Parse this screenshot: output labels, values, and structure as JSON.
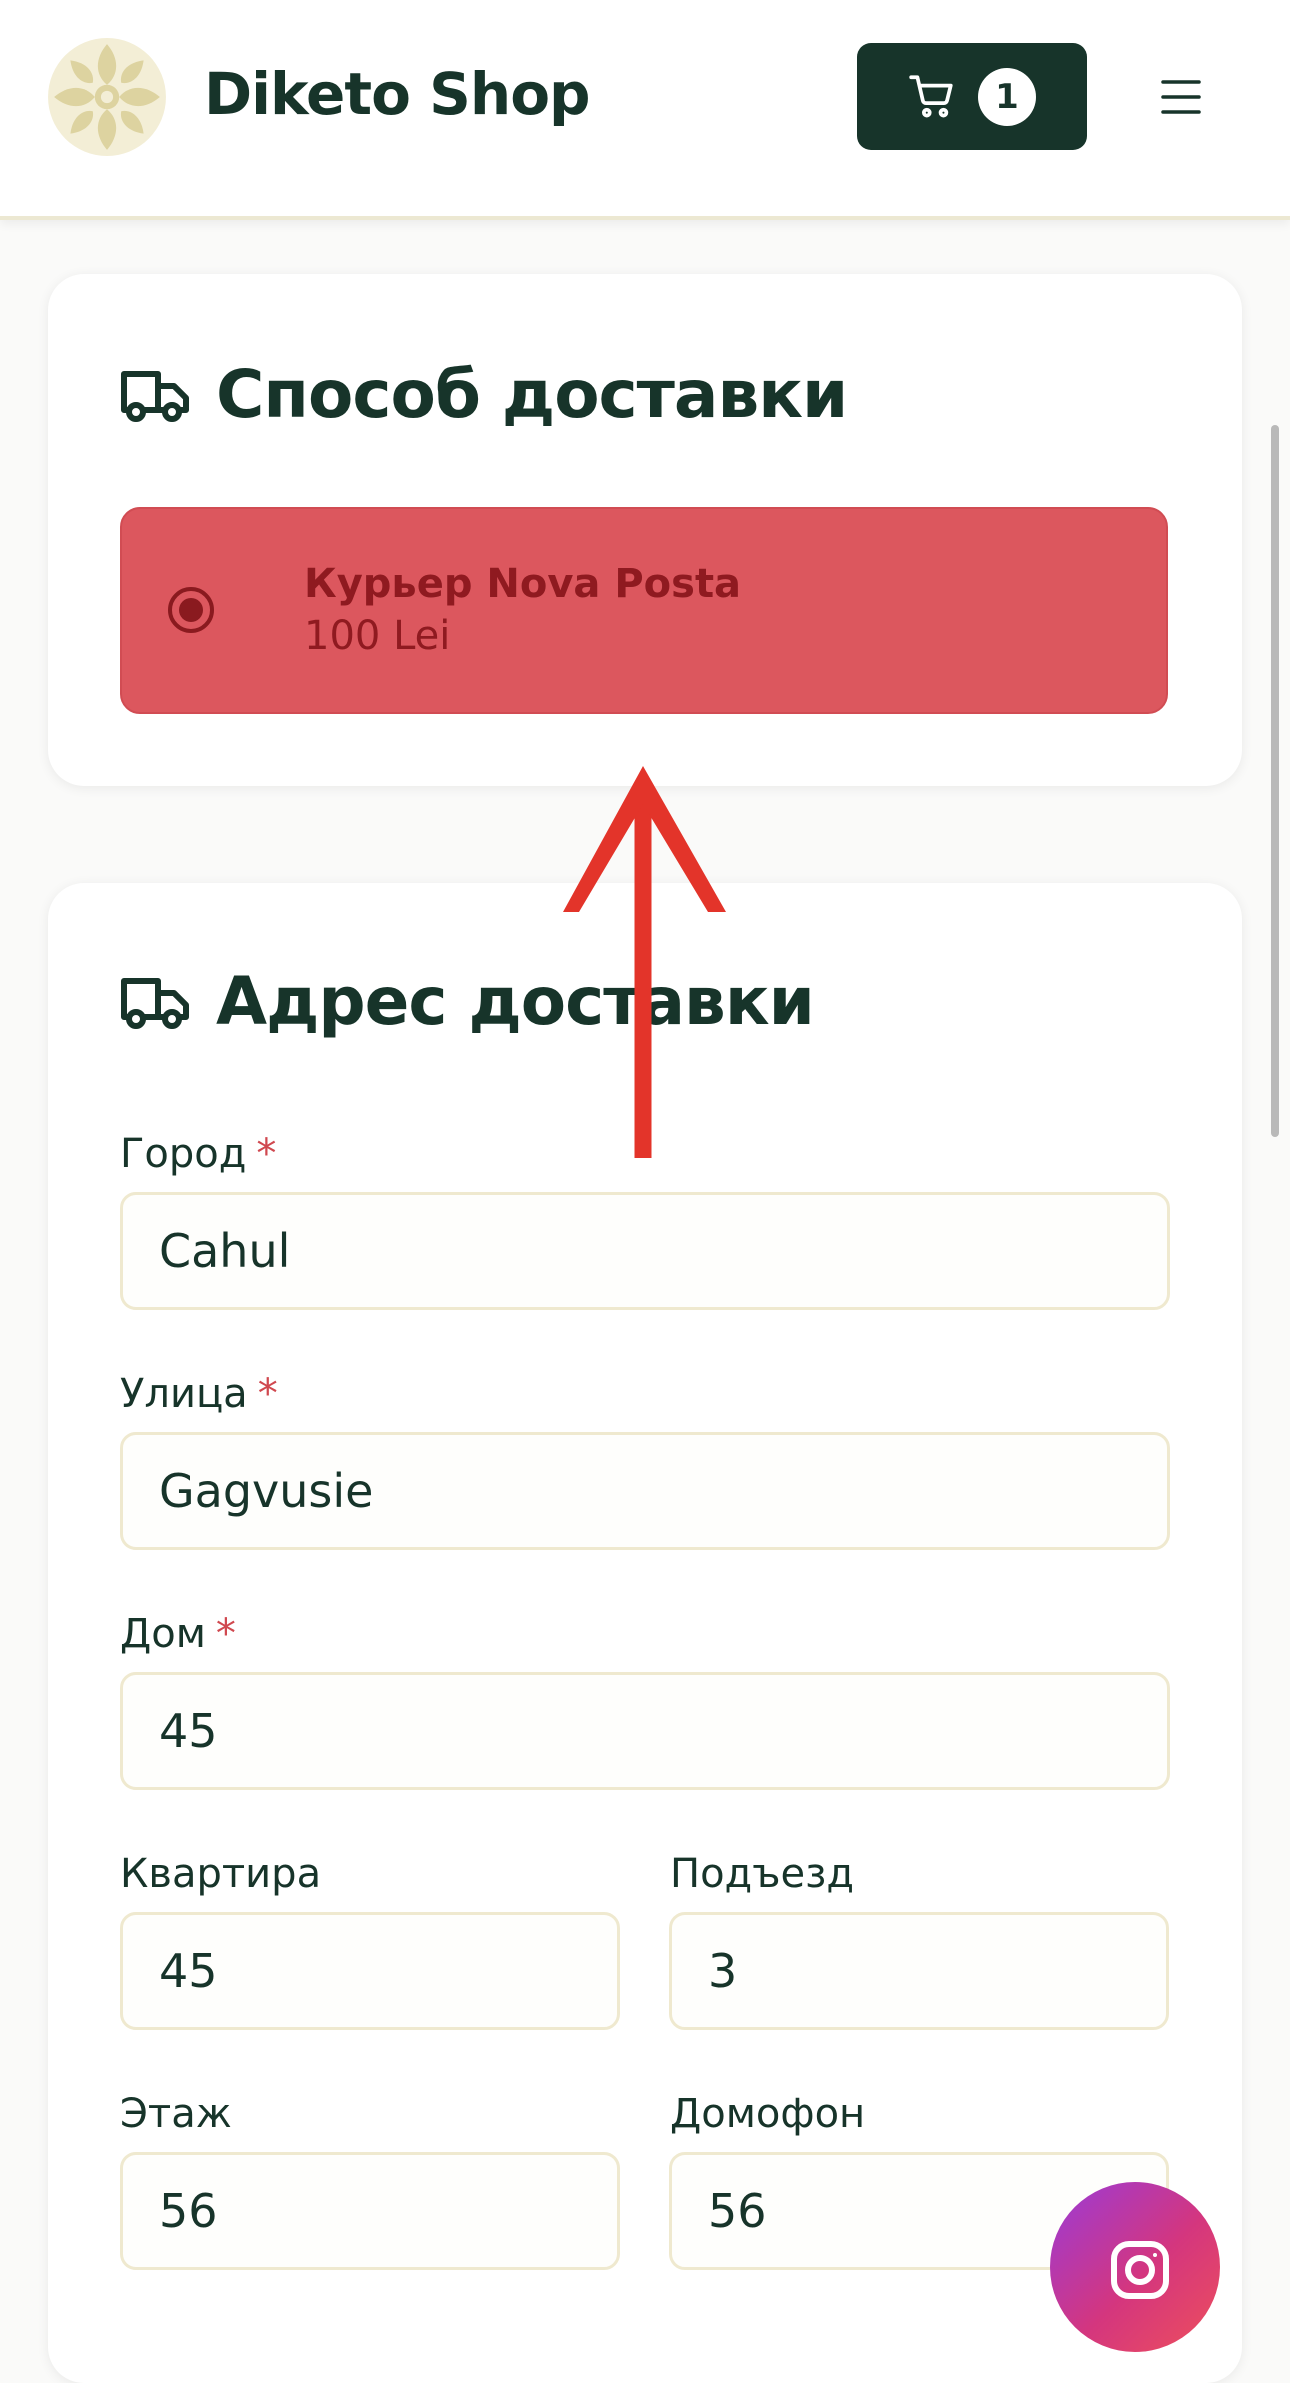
{
  "header": {
    "brand": "Diketo Shop",
    "cart_count": "1"
  },
  "delivery_method": {
    "title": "Способ доставки",
    "option": {
      "name": "Курьер Nova Posta",
      "price": "100 Lei",
      "selected": true
    }
  },
  "address": {
    "title": "Адрес доставки",
    "required_mark": "*",
    "fields": {
      "city": {
        "label": "Город",
        "value": "Cahul"
      },
      "street": {
        "label": "Улица",
        "value": "Gagvusie"
      },
      "house": {
        "label": "Дом",
        "value": "45"
      },
      "apartment": {
        "label": "Квартира",
        "value": "45"
      },
      "entrance": {
        "label": "Подъезд",
        "value": "3"
      },
      "floor": {
        "label": "Этаж",
        "value": "56"
      },
      "intercom": {
        "label": "Домофон",
        "value": "56"
      }
    }
  },
  "colors": {
    "brand_dark": "#17342a",
    "selected_option": "#dc575e",
    "annotation_arrow": "#e3342a",
    "required": "#d0484f"
  },
  "icons": [
    "logo-icon",
    "cart-icon",
    "menu-icon",
    "truck-icon",
    "instagram-icon",
    "annotation-arrow"
  ]
}
